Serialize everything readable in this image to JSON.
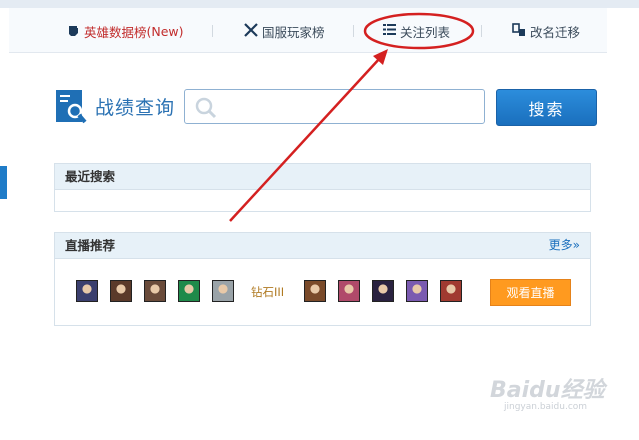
{
  "nav": {
    "hero_label": "英雄数据榜",
    "hero_new": "(New)",
    "national_label": "国服玩家榜",
    "follow_label": "关注列表",
    "rename_label": "改名迁移"
  },
  "search": {
    "title": "战绩查询",
    "placeholder": "",
    "button_label": "搜索"
  },
  "recent": {
    "title": "最近搜索"
  },
  "live": {
    "title": "直播推荐",
    "more_label": "更多»",
    "rank": "钻石III",
    "watch_label": "观看直播",
    "avatars_left": [
      "#3b3f6e",
      "#5b3a2a",
      "#6a4b3a",
      "#1f8a4a",
      "#9aa3a8"
    ],
    "avatars_right": [
      "#7a4a2a",
      "#b04a6a",
      "#2a2240",
      "#7a5ab0",
      "#a03a30"
    ]
  },
  "watermark": {
    "brand": "Baidu经验",
    "url": "jingyan.baidu.com"
  },
  "colors": {
    "accent": "#1f7cc8",
    "annotation": "#d42020",
    "watch": "#ff9a1f"
  }
}
